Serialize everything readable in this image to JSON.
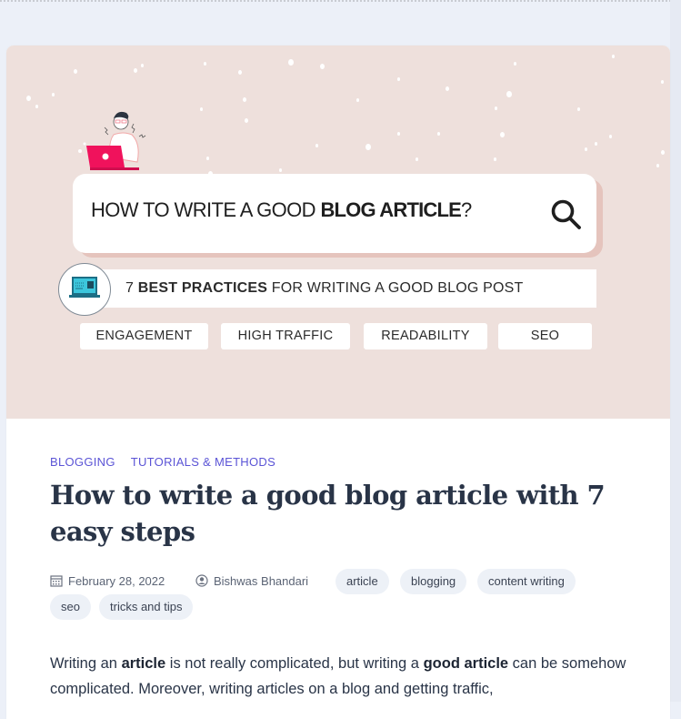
{
  "hero": {
    "headline_regular": "HOW TO WRITE A GOOD ",
    "headline_bold": "BLOG ARTICLE",
    "headline_suffix": "?",
    "subline_number": "7 ",
    "subline_bold": "BEST PRACTICES",
    "subline_rest": " FOR WRITING A GOOD BLOG POST",
    "pills": [
      "ENGAGEMENT",
      "HIGH TRAFFIC",
      "READABILITY",
      "SEO"
    ],
    "colors": {
      "background": "#eee0dc",
      "laptop_accent": "#f0125c",
      "shadow": "#e5c4bd"
    }
  },
  "post": {
    "categories": [
      "BLOGGING",
      "TUTORIALS & METHODS"
    ],
    "title": "How to write a good blog article with 7 easy steps",
    "date": "February 28, 2022",
    "author": "Bishwas Bhandari",
    "tags": [
      "article",
      "blogging",
      "content writing",
      "seo",
      "tricks and tips"
    ],
    "excerpt": {
      "p1": "Writing an ",
      "b1": "article",
      "p2": " is not really complicated, but writing a ",
      "b2": "good article",
      "p3": " can be somehow complicated. Moreover, writing articles on a blog and getting traffic,"
    },
    "colors": {
      "category": "#5b54d6",
      "title": "#293447",
      "tag_bg": "#edf1f7"
    }
  }
}
